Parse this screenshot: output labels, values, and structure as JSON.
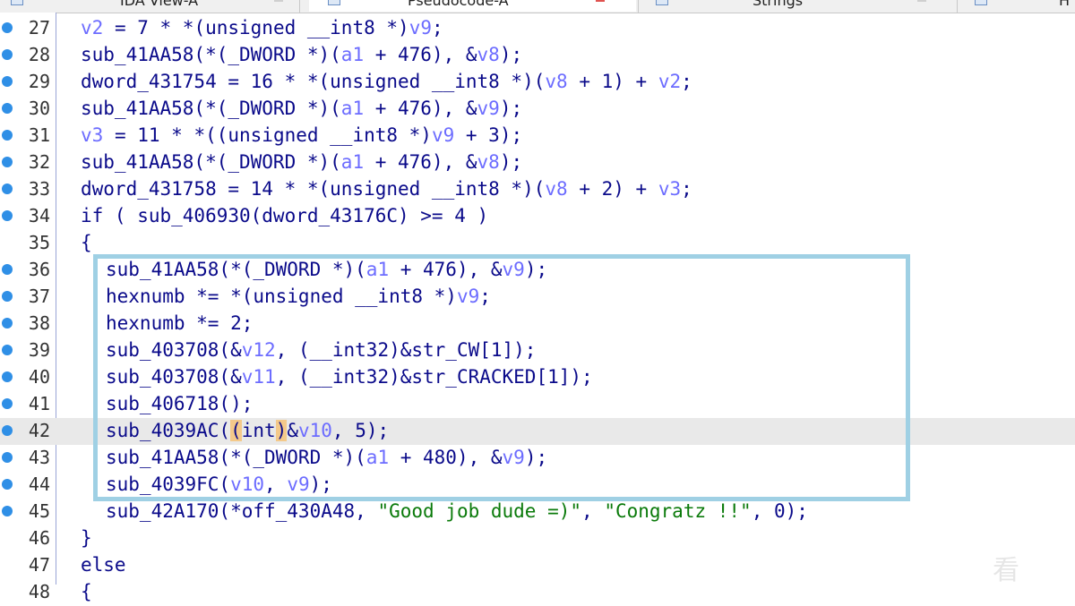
{
  "tabs": [
    {
      "label": "IDA View-A",
      "active": false
    },
    {
      "label": "Pseudocode-A",
      "active": true
    },
    {
      "label": "Strings",
      "active": false
    },
    {
      "label": "H",
      "active": false
    }
  ],
  "lines": [
    {
      "num": "27",
      "bp": true,
      "indent": 0,
      "tokens": [
        [
          "v2",
          "var"
        ],
        [
          " = 7 * *(",
          ""
        ],
        [
          "unsigned __int8 *",
          ""
        ],
        [
          ")",
          ""
        ],
        [
          "v9",
          "var"
        ],
        [
          ";",
          ""
        ]
      ]
    },
    {
      "num": "28",
      "bp": true,
      "indent": 0,
      "tokens": [
        [
          "sub_41AA58(*(_DWORD *)(",
          ""
        ],
        [
          "a1",
          "var"
        ],
        [
          " + 476), &",
          ""
        ],
        [
          "v8",
          "var"
        ],
        [
          ");",
          ""
        ]
      ]
    },
    {
      "num": "29",
      "bp": true,
      "indent": 0,
      "tokens": [
        [
          "dword_431754 = 16 * *(unsigned __int8 *)(",
          ""
        ],
        [
          "v8",
          "var"
        ],
        [
          " + 1) + ",
          ""
        ],
        [
          "v2",
          "var"
        ],
        [
          ";",
          ""
        ]
      ]
    },
    {
      "num": "30",
      "bp": true,
      "indent": 0,
      "tokens": [
        [
          "sub_41AA58(*(_DWORD *)(",
          ""
        ],
        [
          "a1",
          "var"
        ],
        [
          " + 476), &",
          ""
        ],
        [
          "v9",
          "var"
        ],
        [
          ");",
          ""
        ]
      ]
    },
    {
      "num": "31",
      "bp": true,
      "indent": 0,
      "tokens": [
        [
          "v3",
          "var"
        ],
        [
          " = 11 * *((unsigned __int8 *)",
          ""
        ],
        [
          "v9",
          "var"
        ],
        [
          " + 3);",
          ""
        ]
      ]
    },
    {
      "num": "32",
      "bp": true,
      "indent": 0,
      "tokens": [
        [
          "sub_41AA58(*(_DWORD *)(",
          ""
        ],
        [
          "a1",
          "var"
        ],
        [
          " + 476), &",
          ""
        ],
        [
          "v8",
          "var"
        ],
        [
          ");",
          ""
        ]
      ]
    },
    {
      "num": "33",
      "bp": true,
      "indent": 0,
      "tokens": [
        [
          "dword_431758 = 14 * *(unsigned __int8 *)(",
          ""
        ],
        [
          "v8",
          "var"
        ],
        [
          " + 2) + ",
          ""
        ],
        [
          "v3",
          "var"
        ],
        [
          ";",
          ""
        ]
      ]
    },
    {
      "num": "34",
      "bp": true,
      "indent": 0,
      "tokens": [
        [
          "if ( sub_406930(dword_43176C) >= 4 )",
          ""
        ]
      ]
    },
    {
      "num": "35",
      "bp": false,
      "indent": 0,
      "tokens": [
        [
          "{",
          ""
        ]
      ]
    },
    {
      "num": "36",
      "bp": true,
      "indent": 1,
      "tokens": [
        [
          "sub_41AA58(*(_DWORD *)(",
          ""
        ],
        [
          "a1",
          "var"
        ],
        [
          " + 476), &",
          ""
        ],
        [
          "v9",
          "var"
        ],
        [
          ");",
          ""
        ]
      ]
    },
    {
      "num": "37",
      "bp": true,
      "indent": 1,
      "tokens": [
        [
          "hexnumb *= *(unsigned __int8 *)",
          ""
        ],
        [
          "v9",
          "var"
        ],
        [
          ";",
          ""
        ]
      ]
    },
    {
      "num": "38",
      "bp": true,
      "indent": 1,
      "tokens": [
        [
          "hexnumb *= 2;",
          ""
        ]
      ]
    },
    {
      "num": "39",
      "bp": true,
      "indent": 1,
      "tokens": [
        [
          "sub_403708(&",
          ""
        ],
        [
          "v12",
          "var"
        ],
        [
          ", (__int32)&str_CW[1]);",
          ""
        ]
      ]
    },
    {
      "num": "40",
      "bp": true,
      "indent": 1,
      "tokens": [
        [
          "sub_403708(&",
          ""
        ],
        [
          "v11",
          "var"
        ],
        [
          ", (__int32)&str_CRACKED[1]);",
          ""
        ]
      ]
    },
    {
      "num": "41",
      "bp": true,
      "indent": 1,
      "tokens": [
        [
          "sub_406718();",
          ""
        ]
      ]
    },
    {
      "num": "42",
      "bp": true,
      "indent": 1,
      "current": true,
      "tokens": [
        [
          "sub_4039AC(",
          ""
        ],
        [
          "(",
          "hl"
        ],
        [
          "int",
          ""
        ],
        [
          ")",
          "hl"
        ],
        [
          "&",
          ""
        ],
        [
          "v10",
          "var"
        ],
        [
          ", 5);",
          ""
        ]
      ]
    },
    {
      "num": "43",
      "bp": true,
      "indent": 1,
      "tokens": [
        [
          "sub_41AA58(*(_DWORD *)(",
          ""
        ],
        [
          "a1",
          "var"
        ],
        [
          " + 480), &",
          ""
        ],
        [
          "v9",
          "var"
        ],
        [
          ");",
          ""
        ]
      ]
    },
    {
      "num": "44",
      "bp": true,
      "indent": 1,
      "tokens": [
        [
          "sub_4039FC(",
          ""
        ],
        [
          "v10",
          "var"
        ],
        [
          ", ",
          ""
        ],
        [
          "v9",
          "var"
        ],
        [
          ");",
          ""
        ]
      ]
    },
    {
      "num": "45",
      "bp": true,
      "indent": 1,
      "tokens": [
        [
          "sub_42A170(*off_430A48, ",
          ""
        ],
        [
          "\"Good job dude =)\"",
          "str"
        ],
        [
          ", ",
          ""
        ],
        [
          "\"Congratz !!\"",
          "str"
        ],
        [
          ", 0);",
          ""
        ]
      ]
    },
    {
      "num": "46",
      "bp": false,
      "indent": 0,
      "tokens": [
        [
          "}",
          ""
        ]
      ]
    },
    {
      "num": "47",
      "bp": false,
      "indent": 0,
      "tokens": [
        [
          "else",
          ""
        ]
      ]
    },
    {
      "num": "48",
      "bp": false,
      "indent": 0,
      "tokens": [
        [
          "{",
          ""
        ]
      ]
    }
  ],
  "watermark": "看",
  "colors": {
    "variable": "#6c6cff",
    "string": "#0a7a0a",
    "code": "#0a0a8a",
    "breakpoint": "#2f8fe6",
    "box": "#9fd0e4"
  }
}
